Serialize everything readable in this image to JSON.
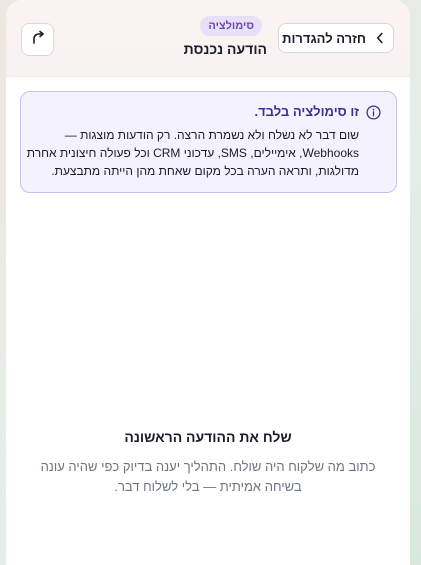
{
  "header": {
    "back_label": "חזרה להגדרות",
    "badge": "סימולציה",
    "title": "הודעה נכנסת",
    "icons": {
      "back": "chevron-right-icon",
      "open": "external-link-icon"
    }
  },
  "notice": {
    "icon": "info-icon",
    "title": "זו סימולציה בלבד.",
    "lines": [
      "שום דבר לא נשלח ולא נשמרת הרצה. רק הודעות מוצגות —",
      "Webhooks, אימיילים, SMS, עדכוני CRM וכל פעולה חיצונית אחרת",
      "מדולגות, ותראה הערה בכל מקום שאחת מהן הייתה מתבצעת."
    ]
  },
  "empty_state": {
    "title": "שלח את ההודעה הראשונה",
    "lines": [
      "כתוב מה שלקוח היה שולח. התהליך יענה בדיוק כפי שהיה עונה",
      "בשיחה אמיתית — בלי לשלוח דבר."
    ]
  },
  "colors": {
    "accent": "#6b45b8",
    "badge_bg": "#e7e0f7",
    "notice_title": "#3b2f93",
    "notice_border": "#c6c3ea",
    "notice_bg": "#f4f3fd",
    "muted_text": "#6c7680"
  }
}
